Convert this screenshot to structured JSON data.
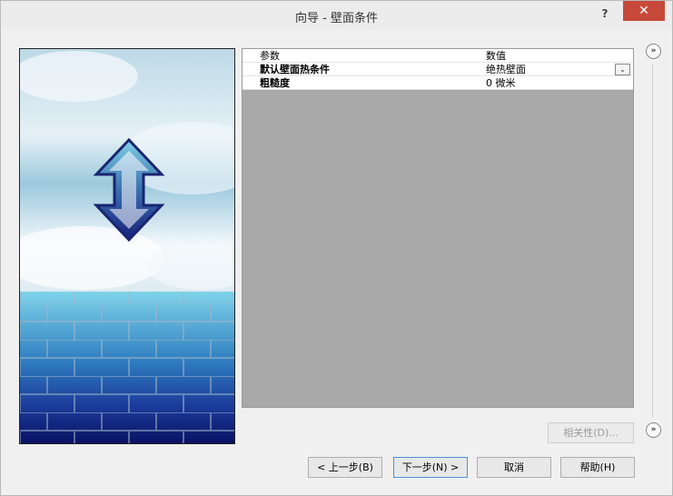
{
  "window": {
    "title": "向导 - 壁面条件",
    "help_label": "?",
    "close_label": "✕"
  },
  "grid": {
    "header": {
      "name": "参数",
      "value": "数值"
    },
    "rows": [
      {
        "name": "默认壁面热条件",
        "value": "绝热壁面",
        "bold": true,
        "has_dropdown": true
      },
      {
        "name": "粗糙度",
        "value": "0 微米",
        "bold": true,
        "has_dropdown": false
      }
    ],
    "dropdown_glyph": "⌄"
  },
  "side": {
    "expand_glyph": "»"
  },
  "buttons": {
    "relevance": "相关性(D)...",
    "prev": "< 上一步(B)",
    "next": "下一步(N) >",
    "cancel": "取消",
    "help": "帮助(H)"
  },
  "colors": {
    "close_bg": "#c7493a",
    "grid_bg": "#a9a9a9",
    "arrow_light": "#7fd0e6",
    "arrow_dark": "#17207a",
    "brick_light": "#7fd4ea",
    "brick_dark": "#0a1060"
  }
}
